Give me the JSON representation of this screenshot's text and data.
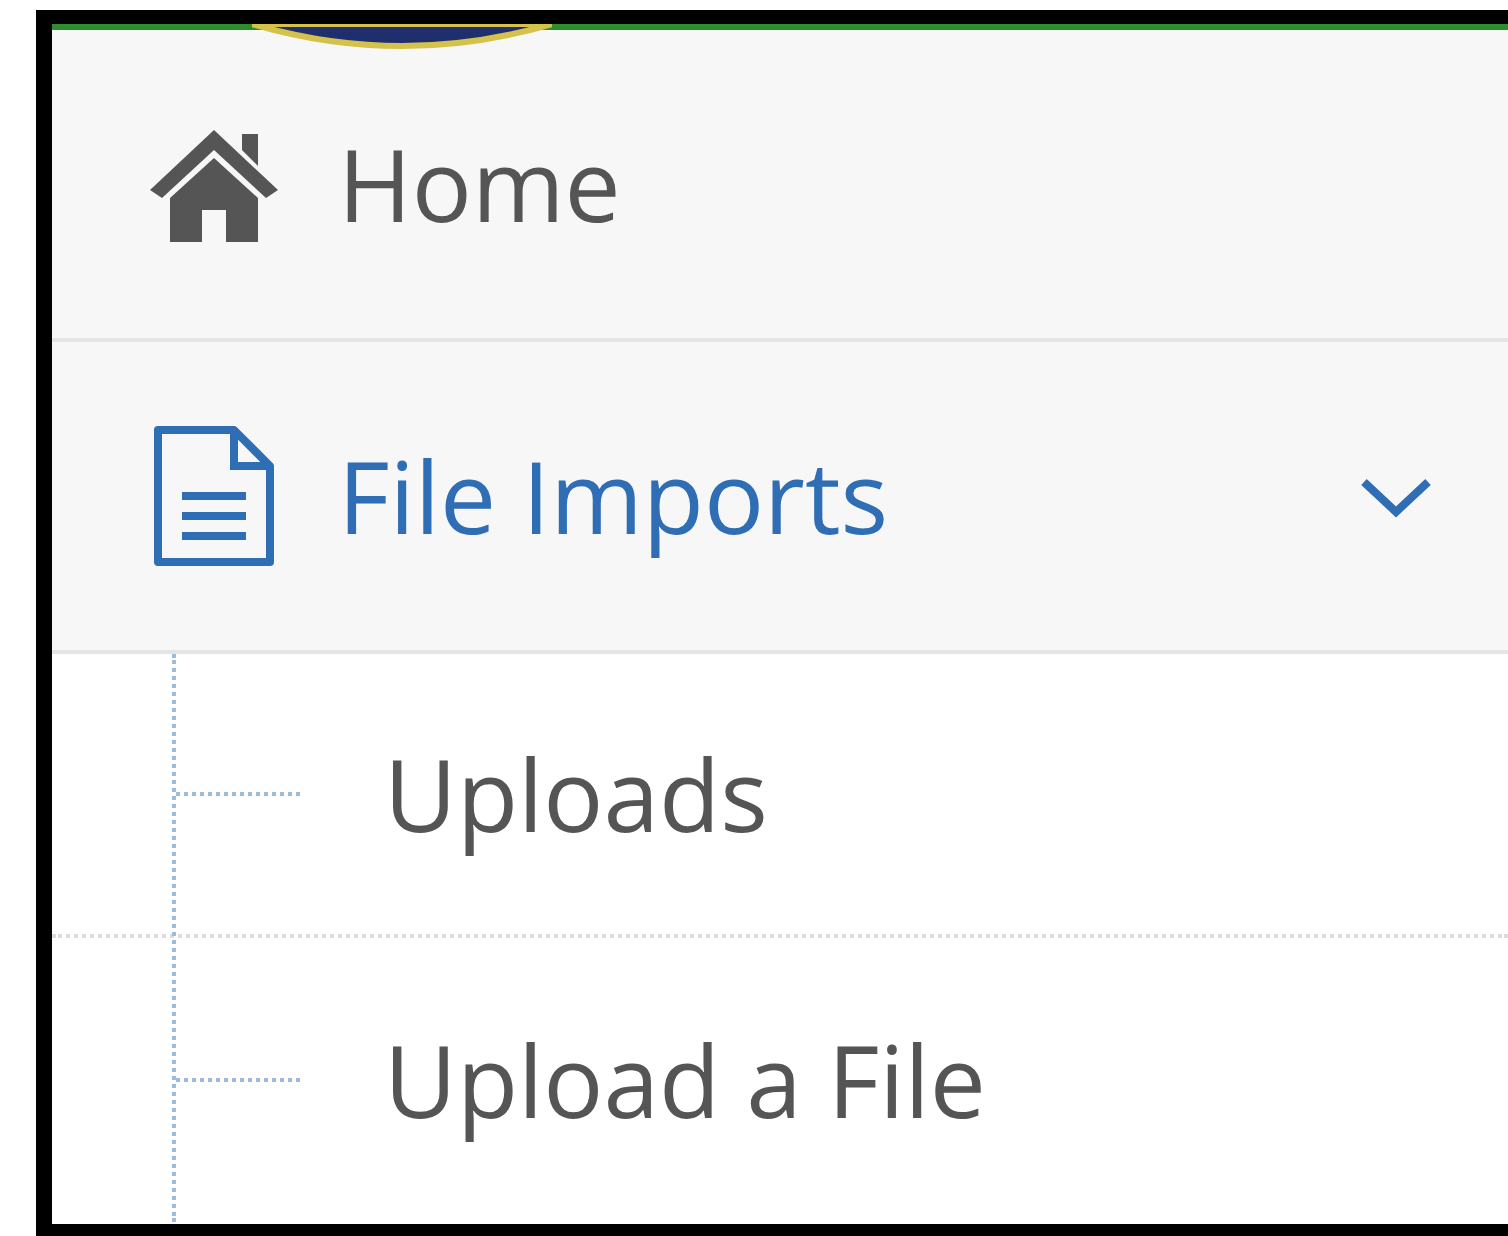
{
  "sidebar": {
    "items": [
      {
        "label": "Home",
        "kind": "home",
        "selected": false
      },
      {
        "label": "File Imports",
        "kind": "file",
        "selected": true,
        "expanded": true,
        "children": [
          {
            "label": "Uploads",
            "selected": false
          },
          {
            "label": "Upload a File",
            "selected": false
          }
        ]
      }
    ]
  }
}
